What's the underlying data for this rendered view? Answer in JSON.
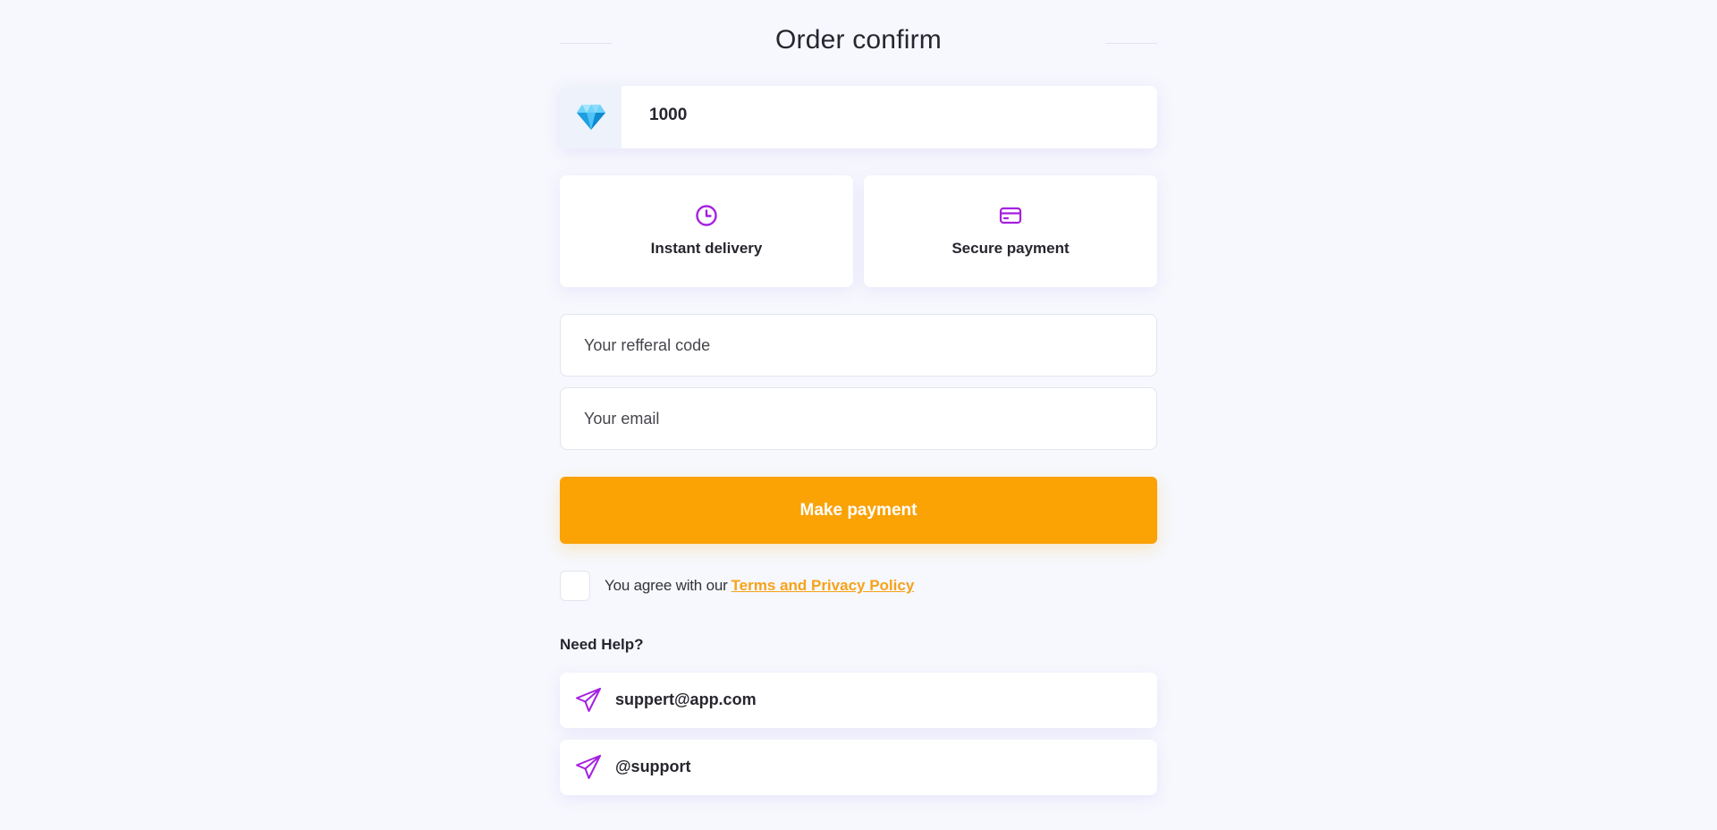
{
  "page": {
    "title": "Order confirm"
  },
  "amount": {
    "icon": "diamond-icon",
    "value": "1000"
  },
  "features": [
    {
      "icon": "clock-icon",
      "label": "Instant delivery"
    },
    {
      "icon": "credit-card-icon",
      "label": "Secure payment"
    }
  ],
  "form": {
    "referral_placeholder": "Your refferal code",
    "referral_value": "",
    "email_placeholder": "Your email",
    "email_value": "",
    "submit_label": "Make payment"
  },
  "agreement": {
    "checked": false,
    "text": "You agree with our",
    "link_text": "Terms and Privacy Policy"
  },
  "help": {
    "title": "Need Help?",
    "contacts": [
      {
        "icon": "paper-plane-icon",
        "text": "suppert@app.com"
      },
      {
        "icon": "paper-plane-icon",
        "text": "@support"
      }
    ]
  },
  "colors": {
    "background": "#f6f8fd",
    "accent": "#fba205",
    "icon_purple": "#a51fe0",
    "diamond": "#29b6f6",
    "text_dark": "#26262e"
  }
}
